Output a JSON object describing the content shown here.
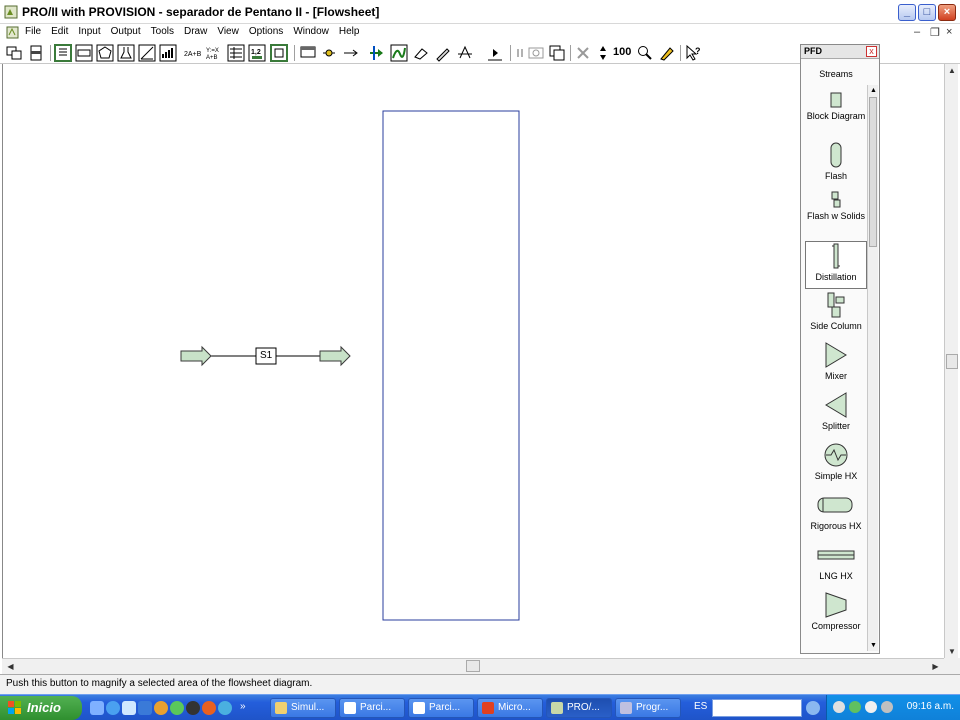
{
  "window": {
    "title": "PRO/II with PROVISION - separador de Pentano II - [Flowsheet]"
  },
  "menu": [
    "File",
    "Edit",
    "Input",
    "Output",
    "Tools",
    "Draw",
    "View",
    "Options",
    "Window",
    "Help"
  ],
  "toolbar": {
    "zoom_label": "100"
  },
  "flowsheet": {
    "stream_label": "S1"
  },
  "pfd_palette": {
    "title": "PFD",
    "close_glyph": "x",
    "items": [
      {
        "label": "Streams",
        "icon": "streams-icon"
      },
      {
        "label": "Block Diagram",
        "icon": "block-diagram-icon"
      },
      {
        "label": "Flash",
        "icon": "flash-drum-icon"
      },
      {
        "label": "Flash w Solids",
        "icon": "flash-solids-icon"
      },
      {
        "label": "Distillation",
        "icon": "distillation-column-icon"
      },
      {
        "label": "Side Column",
        "icon": "side-column-icon"
      },
      {
        "label": "Mixer",
        "icon": "mixer-icon"
      },
      {
        "label": "Splitter",
        "icon": "splitter-icon"
      },
      {
        "label": "Simple HX",
        "icon": "simple-hx-icon"
      },
      {
        "label": "Rigorous HX",
        "icon": "rigorous-hx-icon"
      },
      {
        "label": "LNG HX",
        "icon": "lng-hx-icon"
      },
      {
        "label": "Compressor",
        "icon": "compressor-icon"
      }
    ],
    "selected": "Distillation"
  },
  "statusbar": {
    "text": "Push this button to magnify a selected area of the flowsheet diagram."
  },
  "taskbar": {
    "start_label": "Inicio",
    "tasks": [
      "Simul...",
      "Parci...",
      "Parci...",
      "Micro...",
      "PRO/...",
      "Progr..."
    ],
    "active_task": "PRO/...",
    "language": "ES",
    "clock": "09:16 a.m."
  }
}
